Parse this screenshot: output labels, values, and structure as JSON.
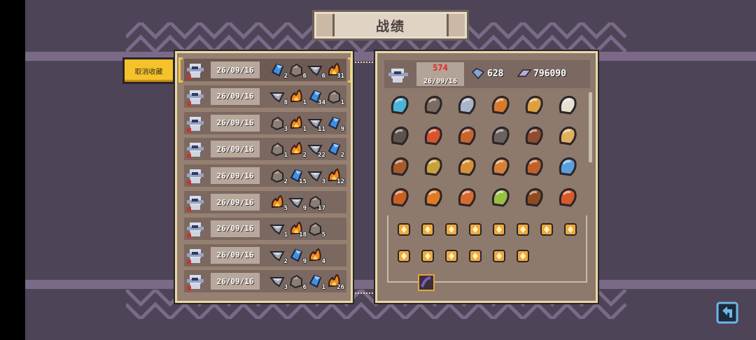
{
  "page_title": "战绩",
  "unfavorite_button": "取消收藏",
  "records": [
    {
      "date": "26/09/16",
      "mats": [
        [
          "crystal",
          "2"
        ],
        [
          "rock",
          "6"
        ],
        [
          "shard",
          "6"
        ],
        [
          "flame",
          "31"
        ]
      ]
    },
    {
      "date": "26/09/16",
      "mats": [
        [
          "shard",
          "8"
        ],
        [
          "flame",
          "1"
        ],
        [
          "crystal",
          "34"
        ],
        [
          "rock",
          "1"
        ]
      ]
    },
    {
      "date": "26/09/16",
      "mats": [
        [
          "rock",
          "3"
        ],
        [
          "flame",
          "1"
        ],
        [
          "shard",
          "11"
        ],
        [
          "crystal",
          "9"
        ]
      ]
    },
    {
      "date": "26/09/16",
      "mats": [
        [
          "rock",
          "1"
        ],
        [
          "flame",
          "2"
        ],
        [
          "shard",
          "22"
        ],
        [
          "crystal",
          "2"
        ]
      ]
    },
    {
      "date": "26/09/16",
      "mats": [
        [
          "rock",
          "2"
        ],
        [
          "crystal",
          "15"
        ],
        [
          "shard",
          "3"
        ],
        [
          "flame",
          "12"
        ]
      ]
    },
    {
      "date": "26/09/16",
      "mats": [
        [
          "flame",
          "5"
        ],
        [
          "shard",
          "9"
        ],
        [
          "rock",
          "17"
        ]
      ]
    },
    {
      "date": "26/09/16",
      "mats": [
        [
          "shard",
          "1"
        ],
        [
          "flame",
          "18"
        ],
        [
          "rock",
          "5"
        ]
      ]
    },
    {
      "date": "26/09/16",
      "mats": [
        [
          "shard",
          "2"
        ],
        [
          "crystal",
          "9"
        ],
        [
          "flame",
          "4"
        ]
      ]
    },
    {
      "date": "26/09/16",
      "mats": [
        [
          "shard",
          "3"
        ],
        [
          "rock",
          "6"
        ],
        [
          "crystal",
          "1"
        ],
        [
          "flame",
          "26"
        ]
      ]
    }
  ],
  "detail": {
    "kills": "574",
    "date": "26/09/16",
    "gems": "628",
    "score": "796090"
  },
  "colors": {
    "background": "#4e4457",
    "panel_border": "#e8d9a8",
    "button_yellow": "#f6c22c",
    "kills_red": "#e2262c"
  },
  "icons": {
    "back": "back-arrow-icon",
    "avatar": "knight-helmet-icon",
    "gem": "gem-icon",
    "score": "score-icon"
  }
}
